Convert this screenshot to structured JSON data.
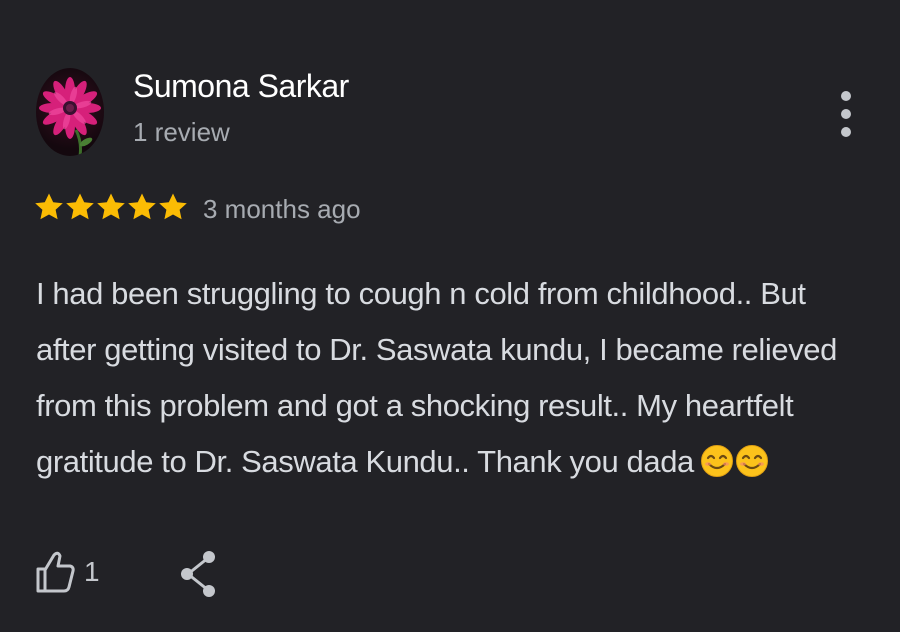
{
  "review": {
    "author": "Sumona Sarkar",
    "review_count": "1 review",
    "rating": 5,
    "rating_max": 5,
    "date": "3 months ago",
    "text_lines": [
      "I had been struggling to cough n cold from childhood.. But",
      "after getting visited to Dr. Saswata kundu, I became relieved",
      "from this problem and got a shocking result.. My heartfelt",
      "gratitude to Dr. Saswata Kundu.. Thank you dada"
    ],
    "emojis": [
      "😊",
      "😊"
    ],
    "like_count": "1"
  },
  "colors": {
    "background": "#222226",
    "star": "#fbbc04",
    "name": "#ffffff",
    "secondary_text": "#a7abb1",
    "body_text": "#d8dbe0"
  },
  "icons": {
    "avatar": "pink-flower-avatar",
    "more": "more-vertical-icon",
    "star": "star-icon",
    "like": "thumbs-up-icon",
    "share": "share-icon"
  }
}
